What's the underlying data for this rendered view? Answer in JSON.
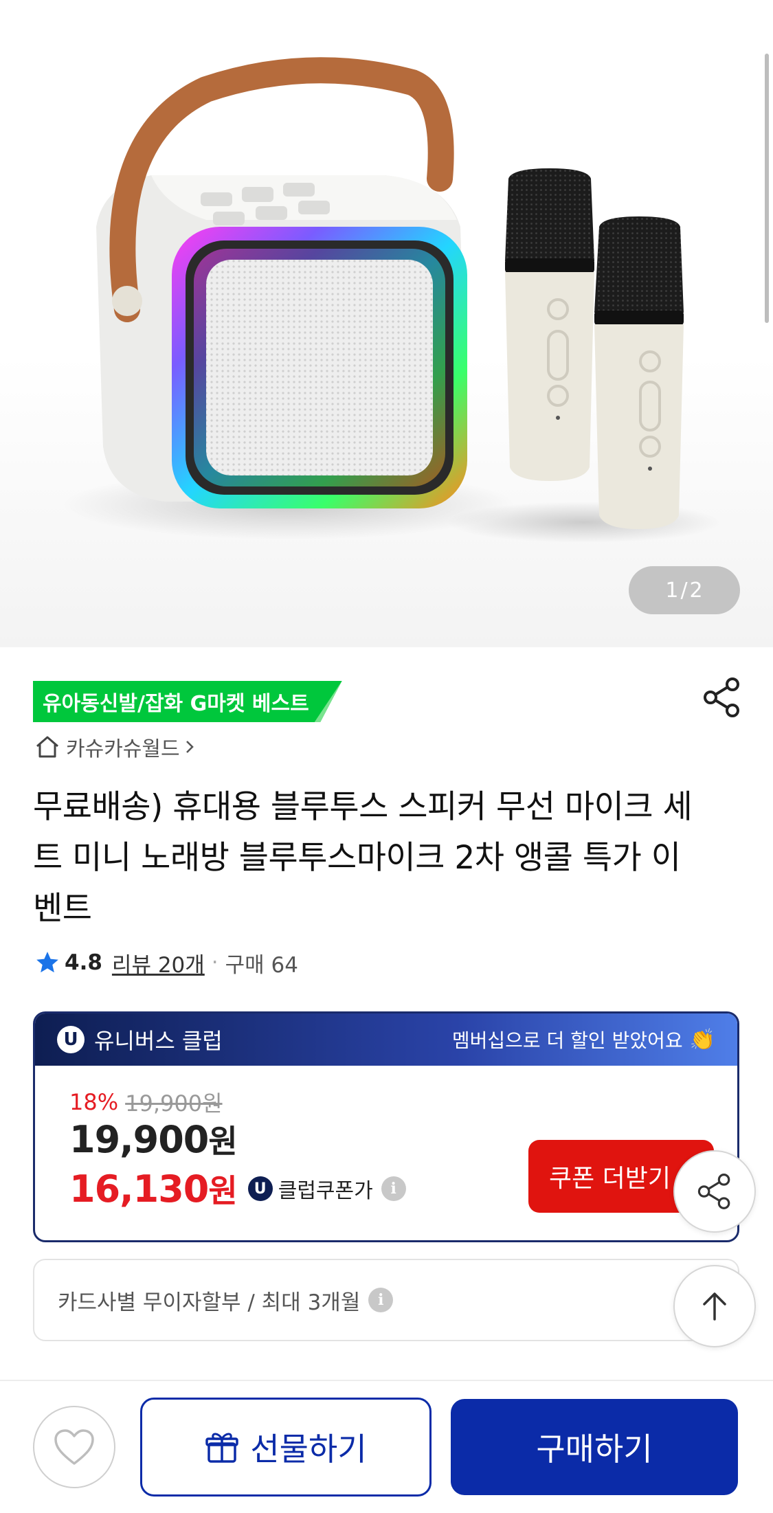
{
  "product_image": {
    "alt": "휴대용 블루투스 스피커 무선 마이크 세트",
    "pager_current": "1",
    "pager_total": "2",
    "pager_separator": "/"
  },
  "category_badge": "유아동신발/잡화 G마켓 베스트",
  "store_name": "카슈카슈월드",
  "product_title": "무료배송) 휴대용 블루투스 스피커 무선 마이크 세트 미니 노래방 블루투스마이크 2차 앵콜 특가 이벤트",
  "rating": {
    "score": "4.8",
    "reviews_label": "리뷰 20개",
    "separator": "·",
    "purchases_label": "구매 64"
  },
  "club": {
    "badge_letter": "U",
    "name": "유니버스 클럽",
    "message": "멤버십으로 더 할인 받았어요",
    "message_emoji": "👏"
  },
  "price": {
    "discount_rate": "18%",
    "original_price": "19,900원",
    "sale_price_number": "19,900",
    "currency": "원",
    "club_price_number": "16,130",
    "club_badge_letter": "U",
    "club_price_label": "클럽쿠폰가",
    "info_glyph": "i",
    "coupon_button_label": "쿠폰 더받기"
  },
  "installment_text": "카드사별 무이자할부 / 최대 3개월",
  "bottom_bar": {
    "gift_label": "선물하기",
    "buy_label": "구매하기"
  },
  "colors": {
    "brand_blue": "#0b2ba8",
    "badge_green": "#00c73c",
    "discount_red": "#e51c23",
    "coupon_red": "#e0140f",
    "star_blue": "#1a73e8"
  }
}
